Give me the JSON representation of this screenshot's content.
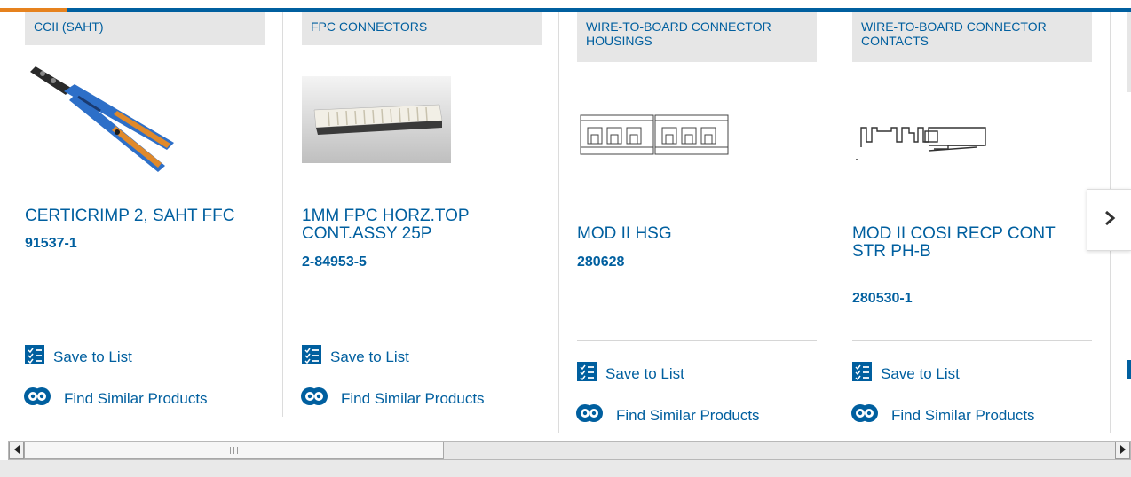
{
  "carousel": {
    "cards": [
      {
        "category": "CCII (SAHT)",
        "name": "CERTICRIMP 2, SAHT FFC",
        "part_number": "91537-1",
        "image_icon": "crimp-tool-image"
      },
      {
        "category": "FPC CONNECTORS",
        "name": "1MM FPC HORZ.TOP CONT.ASSY 25P",
        "part_number": "2-84953-5",
        "image_icon": "fpc-connector-image"
      },
      {
        "category": "WIRE-TO-BOARD CONNECTOR HOUSINGS",
        "name": "MOD II HSG",
        "part_number": "280628",
        "image_icon": "housing-drawing-image"
      },
      {
        "category": "WIRE-TO-BOARD CONNECTOR CONTACTS",
        "name": "MOD II COSI RECP CONT STR PH-B",
        "part_number": "280530-1",
        "image_icon": "contact-drawing-image"
      }
    ],
    "actions": {
      "save_label": "Save to List",
      "find_label": "Find Similar Products",
      "save_icon": "checklist-icon",
      "find_icon": "similar-products-icon"
    },
    "next_icon": "chevron-right-icon"
  },
  "colors": {
    "link_blue": "#005f9f",
    "accent_orange": "#e6821e",
    "category_bg": "#e6e6e6"
  }
}
